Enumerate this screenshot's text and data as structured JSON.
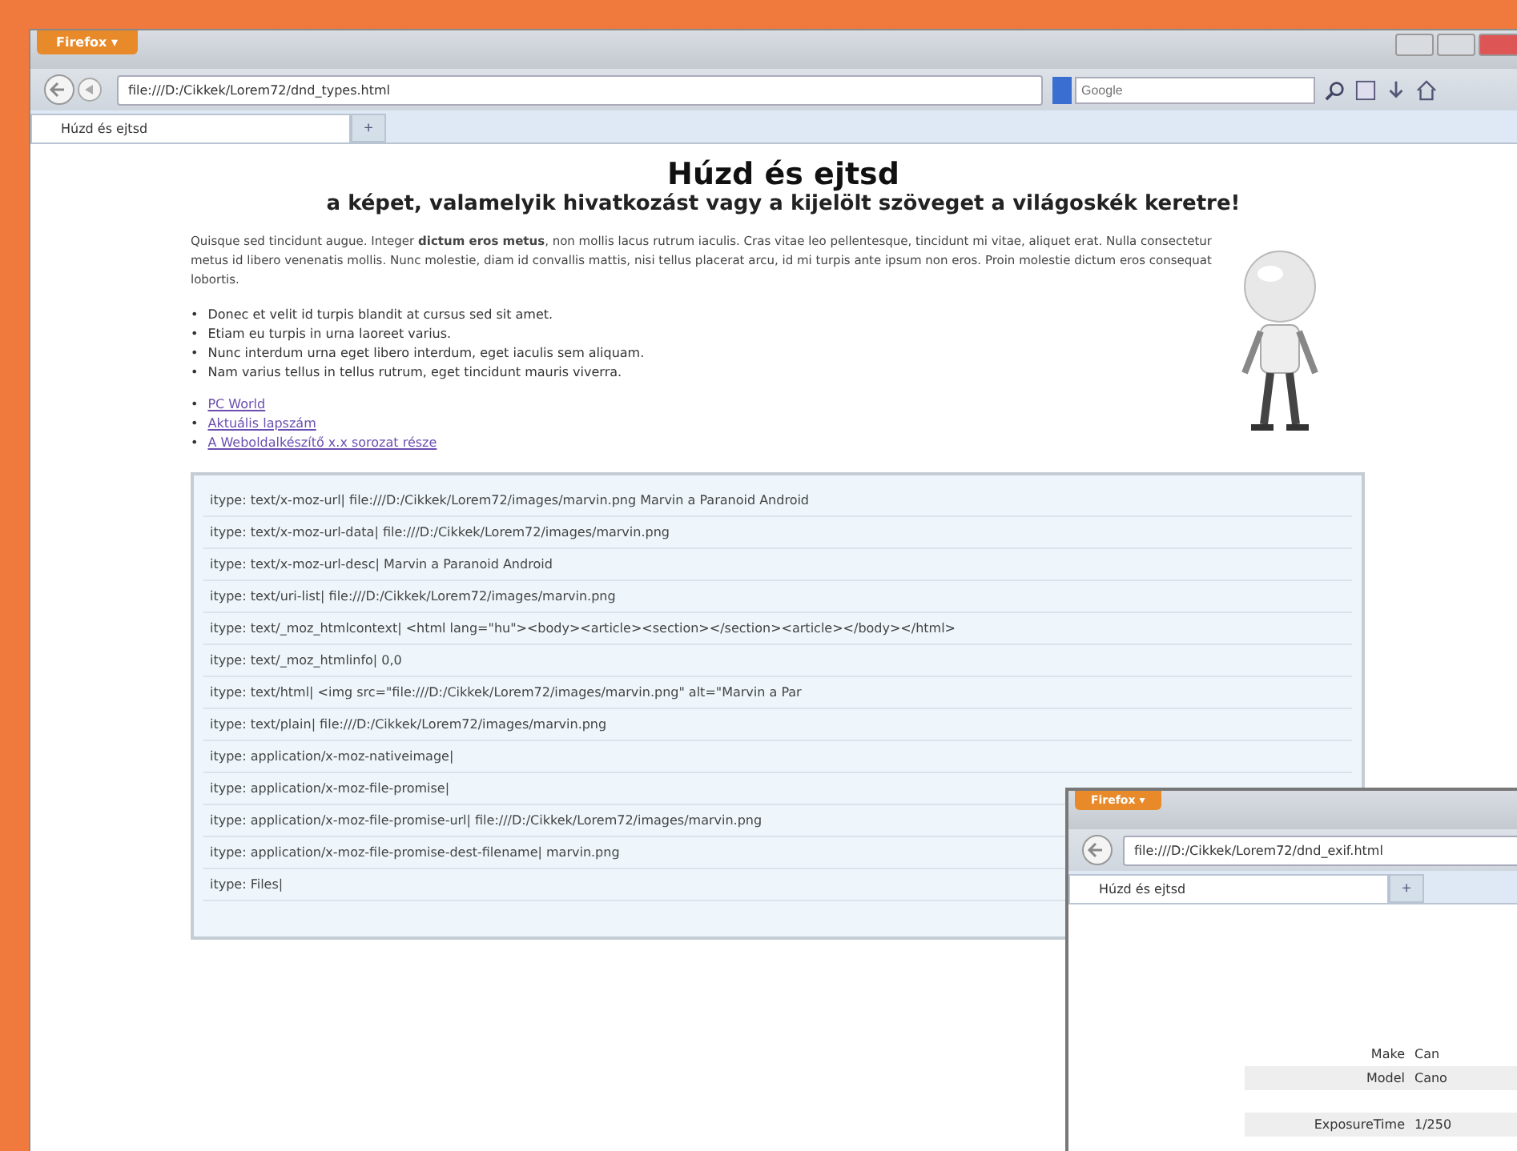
{
  "window": {
    "menu_button": "Firefox ▾",
    "address": "file:///D:/Cikkek/Lorem72/dnd_types.html",
    "search": {
      "placeholder": "Google"
    },
    "tabs": [
      {
        "title": "Húzd és ejtsd",
        "selected": true
      }
    ],
    "new_tab": "+"
  },
  "page": {
    "title": "Húzd és ejtsd",
    "subtitle": "a képet, valamelyik hivatkozást vagy a kijelölt szöveget a világoskék keretre!",
    "paragraph": "Quisque sed tincidunt augue. Integer **dictum eros metus**, non mollis lacus rutrum iaculis. Cras vitae leo pellentesque, tincidunt mi vitae, aliquet erat. Nulla consectetur metus id libero venenatis mollis. Nunc molestie, diam id convallis mattis, nisi tellus placerat arcu, id mi turpis ante ipsum non eros. Proin molestie dictum eros consequat lobortis.",
    "list_marker": "•",
    "bullets": [
      "Donec et velit id turpis blandit at cursus sed sit amet.",
      "Etiam eu turpis in urna laoreet varius.",
      "Nunc interdum urna eget libero interdum, eget iaculis sem aliquam.",
      "Nam varius tellus in tellus rutrum, eget tincidunt mauris viverra."
    ],
    "links": [
      "PC World",
      "Aktuális lapszám",
      "A Weboldalkészítő x.x sorozat része"
    ],
    "drop_rows": [
      "itype: text/x-moz-url| file:///D:/Cikkek/Lorem72/images/marvin.png Marvin a Paranoid Android",
      "itype: text/x-moz-url-data| file:///D:/Cikkek/Lorem72/images/marvin.png",
      "itype: text/x-moz-url-desc| Marvin a Paranoid Android",
      "itype: text/uri-list| file:///D:/Cikkek/Lorem72/images/marvin.png",
      "itype: text/_moz_htmlcontext| <html lang=\"hu\"><body><article><section></section><article></body></html>",
      "itype: text/_moz_htmlinfo| 0,0",
      "itype: text/html| <img src=\"file:///D:/Cikkek/Lorem72/images/marvin.png\" alt=\"Marvin a Par",
      "itype: text/plain| file:///D:/Cikkek/Lorem72/images/marvin.png",
      "itype: application/x-moz-nativeimage|",
      "itype: application/x-moz-file-promise|",
      "itype: application/x-moz-file-promise-url| file:///D:/Cikkek/Lorem72/images/marvin.png",
      "itype: application/x-moz-file-promise-dest-filename| marvin.png",
      "itype: Files|"
    ]
  },
  "second_window": {
    "menu_button": "Firefox ▾",
    "address": "file:///D:/Cikkek/Lorem72/dnd_exif.html",
    "tabs": [
      {
        "title": "Húzd és ejtsd",
        "selected": true
      }
    ],
    "new_tab": "+",
    "exif_rows": [
      {
        "key": "Make",
        "value": "Can",
        "shaded": false
      },
      {
        "key": "Model",
        "value": "Cano",
        "shaded": true
      },
      {
        "key": "ExposureTime",
        "value": "1/250",
        "shaded": true
      }
    ]
  }
}
